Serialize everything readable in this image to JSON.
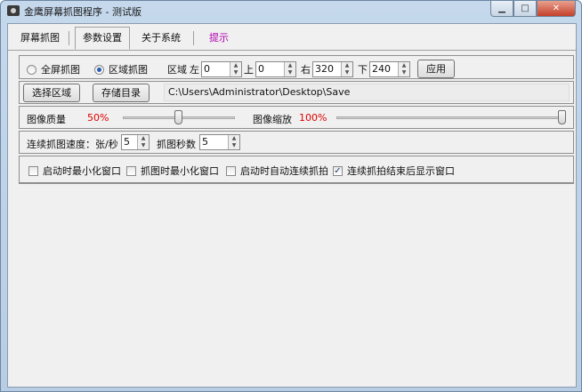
{
  "window": {
    "title": "金鹰屏幕抓图程序 - 测试版",
    "min_label": "▁",
    "max_label": "□",
    "close_label": "✕"
  },
  "tabs": [
    {
      "label": "屏幕抓图",
      "active": false
    },
    {
      "label": "参数设置",
      "active": true
    },
    {
      "label": "关于系统",
      "active": false
    },
    {
      "label": "提示",
      "active": false
    }
  ],
  "capture_mode": {
    "fullscreen_label": "全屏抓图",
    "region_label": "区域抓图",
    "selected": "region",
    "region_prefix": "区域",
    "left_label": "左",
    "left_value": "0",
    "top_label": "上",
    "top_value": "0",
    "right_label": "右",
    "right_value": "320",
    "bottom_label": "下",
    "bottom_value": "240",
    "apply_label": "应用"
  },
  "paths": {
    "select_region_label": "选择区域",
    "storage_dir_label": "存储目录",
    "save_path": "C:\\Users\\Administrator\\Desktop\\Save"
  },
  "image": {
    "quality_label": "图像质量",
    "quality_value": "50%",
    "quality_fraction": 0.5,
    "scale_label": "图像缩放",
    "scale_value": "100%",
    "scale_fraction": 1.0
  },
  "continuous": {
    "speed_label": "连续抓图速度：张/秒",
    "speed_value": "5",
    "seconds_label": "抓图秒数",
    "seconds_value": "5"
  },
  "options": [
    {
      "label": "启动时最小化窗口",
      "checked": false
    },
    {
      "label": "抓图时最小化窗口",
      "checked": false
    },
    {
      "label": "启动时自动连续抓拍",
      "checked": false
    },
    {
      "label": "连续抓拍结束后显示窗口",
      "checked": true
    }
  ],
  "colors": {
    "accent_red": "#e00000",
    "hint_magenta": "#b000b0"
  }
}
